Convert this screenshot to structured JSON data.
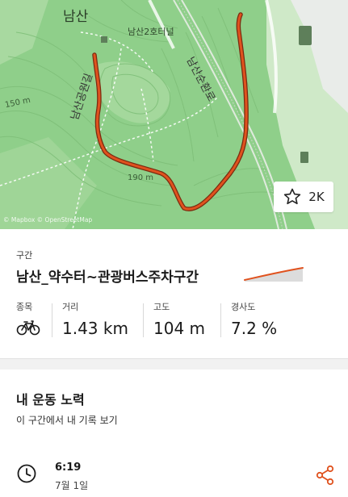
{
  "map": {
    "label_namsan": "남산",
    "label_tunnel": "남산2호터널",
    "label_elev_150": "150 m",
    "label_elev_190": "190 m",
    "label_road_left": "남산공원길",
    "label_road_right": "남산순환로",
    "attribution": "© Mapbox © OpenStreetMap",
    "route_color": "#e0521e"
  },
  "kudos": {
    "icon": "star-icon",
    "count": "2K"
  },
  "segment": {
    "tag": "구간",
    "name": "남산_약수터~관광버스주차구간",
    "profile_icon": "elevation-profile-icon",
    "stats": [
      {
        "label": "종목",
        "value": "",
        "icon": "bike-icon"
      },
      {
        "label": "거리",
        "value": "1.43 km"
      },
      {
        "label": "고도",
        "value": "104 m"
      },
      {
        "label": "경사도",
        "value": "7.2 %"
      }
    ]
  },
  "performance": {
    "title": "내 운동 노력",
    "subtitle": "이 구간에서 내 기록 보기",
    "effort": {
      "time": "6:19",
      "date": "7월 1일",
      "clock_icon": "clock-icon",
      "share_icon": "share-icon"
    }
  },
  "colors": {
    "accent": "#e0521e",
    "map_green": "#8fcf8a",
    "text": "#1a1a1a"
  }
}
